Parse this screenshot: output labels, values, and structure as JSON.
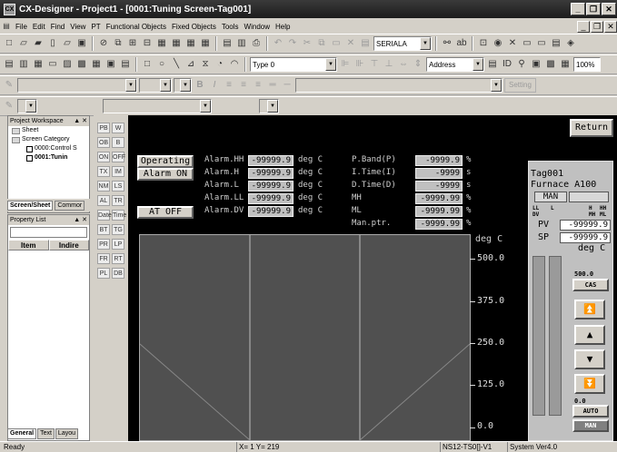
{
  "window": {
    "title": "CX-Designer - Project1 - [0001:Tuning Screen-Tag001]"
  },
  "menu": [
    "File",
    "Edit",
    "Find",
    "View",
    "PT",
    "Functional Objects",
    "Fixed Objects",
    "Tools",
    "Window",
    "Help"
  ],
  "toolbar": {
    "serial_combo": "SERIALA",
    "type_combo": "Type 0",
    "address_combo": "Address",
    "setting_label": "Setting",
    "zoom": "100%"
  },
  "workspace": {
    "title": "Project Workspace",
    "tree": [
      "Sheet",
      "Screen Category",
      "0000:Control S",
      "0001:Tunin"
    ],
    "tabs": [
      "Screen/Sheet",
      "Commor"
    ]
  },
  "property_list": {
    "title": "Property List",
    "columns": [
      "Item",
      "Indire"
    ],
    "tabs": [
      "General",
      "Text",
      "Layou"
    ]
  },
  "palette": [
    "PB",
    "W",
    "OB",
    "B",
    "ON",
    "OFF",
    "TX",
    "IM",
    "NM",
    "LS",
    "AL",
    "TR",
    "Date",
    "Time",
    "BT",
    "TG",
    "PR",
    "LP",
    "FR",
    "RT",
    "PL",
    "DB"
  ],
  "screen": {
    "return_label": "Return",
    "operating_label": "Operating",
    "alarm_on_label": "Alarm ON",
    "at_off_label": "AT OFF",
    "alarms": [
      {
        "label": "Alarm.HH",
        "value": "-99999.9",
        "unit": "deg C"
      },
      {
        "label": "Alarm.H",
        "value": "-99999.9",
        "unit": "deg C"
      },
      {
        "label": "Alarm.L",
        "value": "-99999.9",
        "unit": "deg C"
      },
      {
        "label": "Alarm.LL",
        "value": "-99999.9",
        "unit": "deg C"
      },
      {
        "label": "Alarm.DV",
        "value": "-99999.9",
        "unit": "deg C"
      }
    ],
    "params": [
      {
        "label": "P.Band(P)",
        "value": "-9999.9",
        "unit": "%"
      },
      {
        "label": "I.Time(I)",
        "value": "-9999",
        "unit": "s"
      },
      {
        "label": "D.Time(D)",
        "value": "-9999",
        "unit": "s"
      },
      {
        "label": "MH",
        "value": "-9999.99",
        "unit": "%"
      },
      {
        "label": "ML",
        "value": "-9999.99",
        "unit": "%"
      },
      {
        "label": "Man.ptr.",
        "value": "-9999.99",
        "unit": "%"
      }
    ],
    "trend": {
      "unit": "deg C",
      "ticks": [
        "500.0",
        "375.0",
        "250.0",
        "125.0",
        "0.0"
      ]
    },
    "faceplate": {
      "tag": "Tag001",
      "name": "Furnace A100",
      "mode": "MAN",
      "alarm_labels": [
        "LL",
        "L",
        "H",
        "HH",
        "DV",
        "MH",
        "ML"
      ],
      "pv_label": "PV",
      "pv_value": "-99999.9",
      "sp_label": "SP",
      "sp_value": "-99999.9",
      "unit": "deg C",
      "scale_top": "500.0",
      "cas_label": "CAS",
      "scale_bottom": "0.0",
      "auto_label": "AUTO",
      "man_label": "MAN"
    }
  },
  "status": {
    "ready": "Ready",
    "coords": "X=  1 Y= 219",
    "model": "NS12-TS0[]-V1",
    "version": "System Ver4.0"
  }
}
